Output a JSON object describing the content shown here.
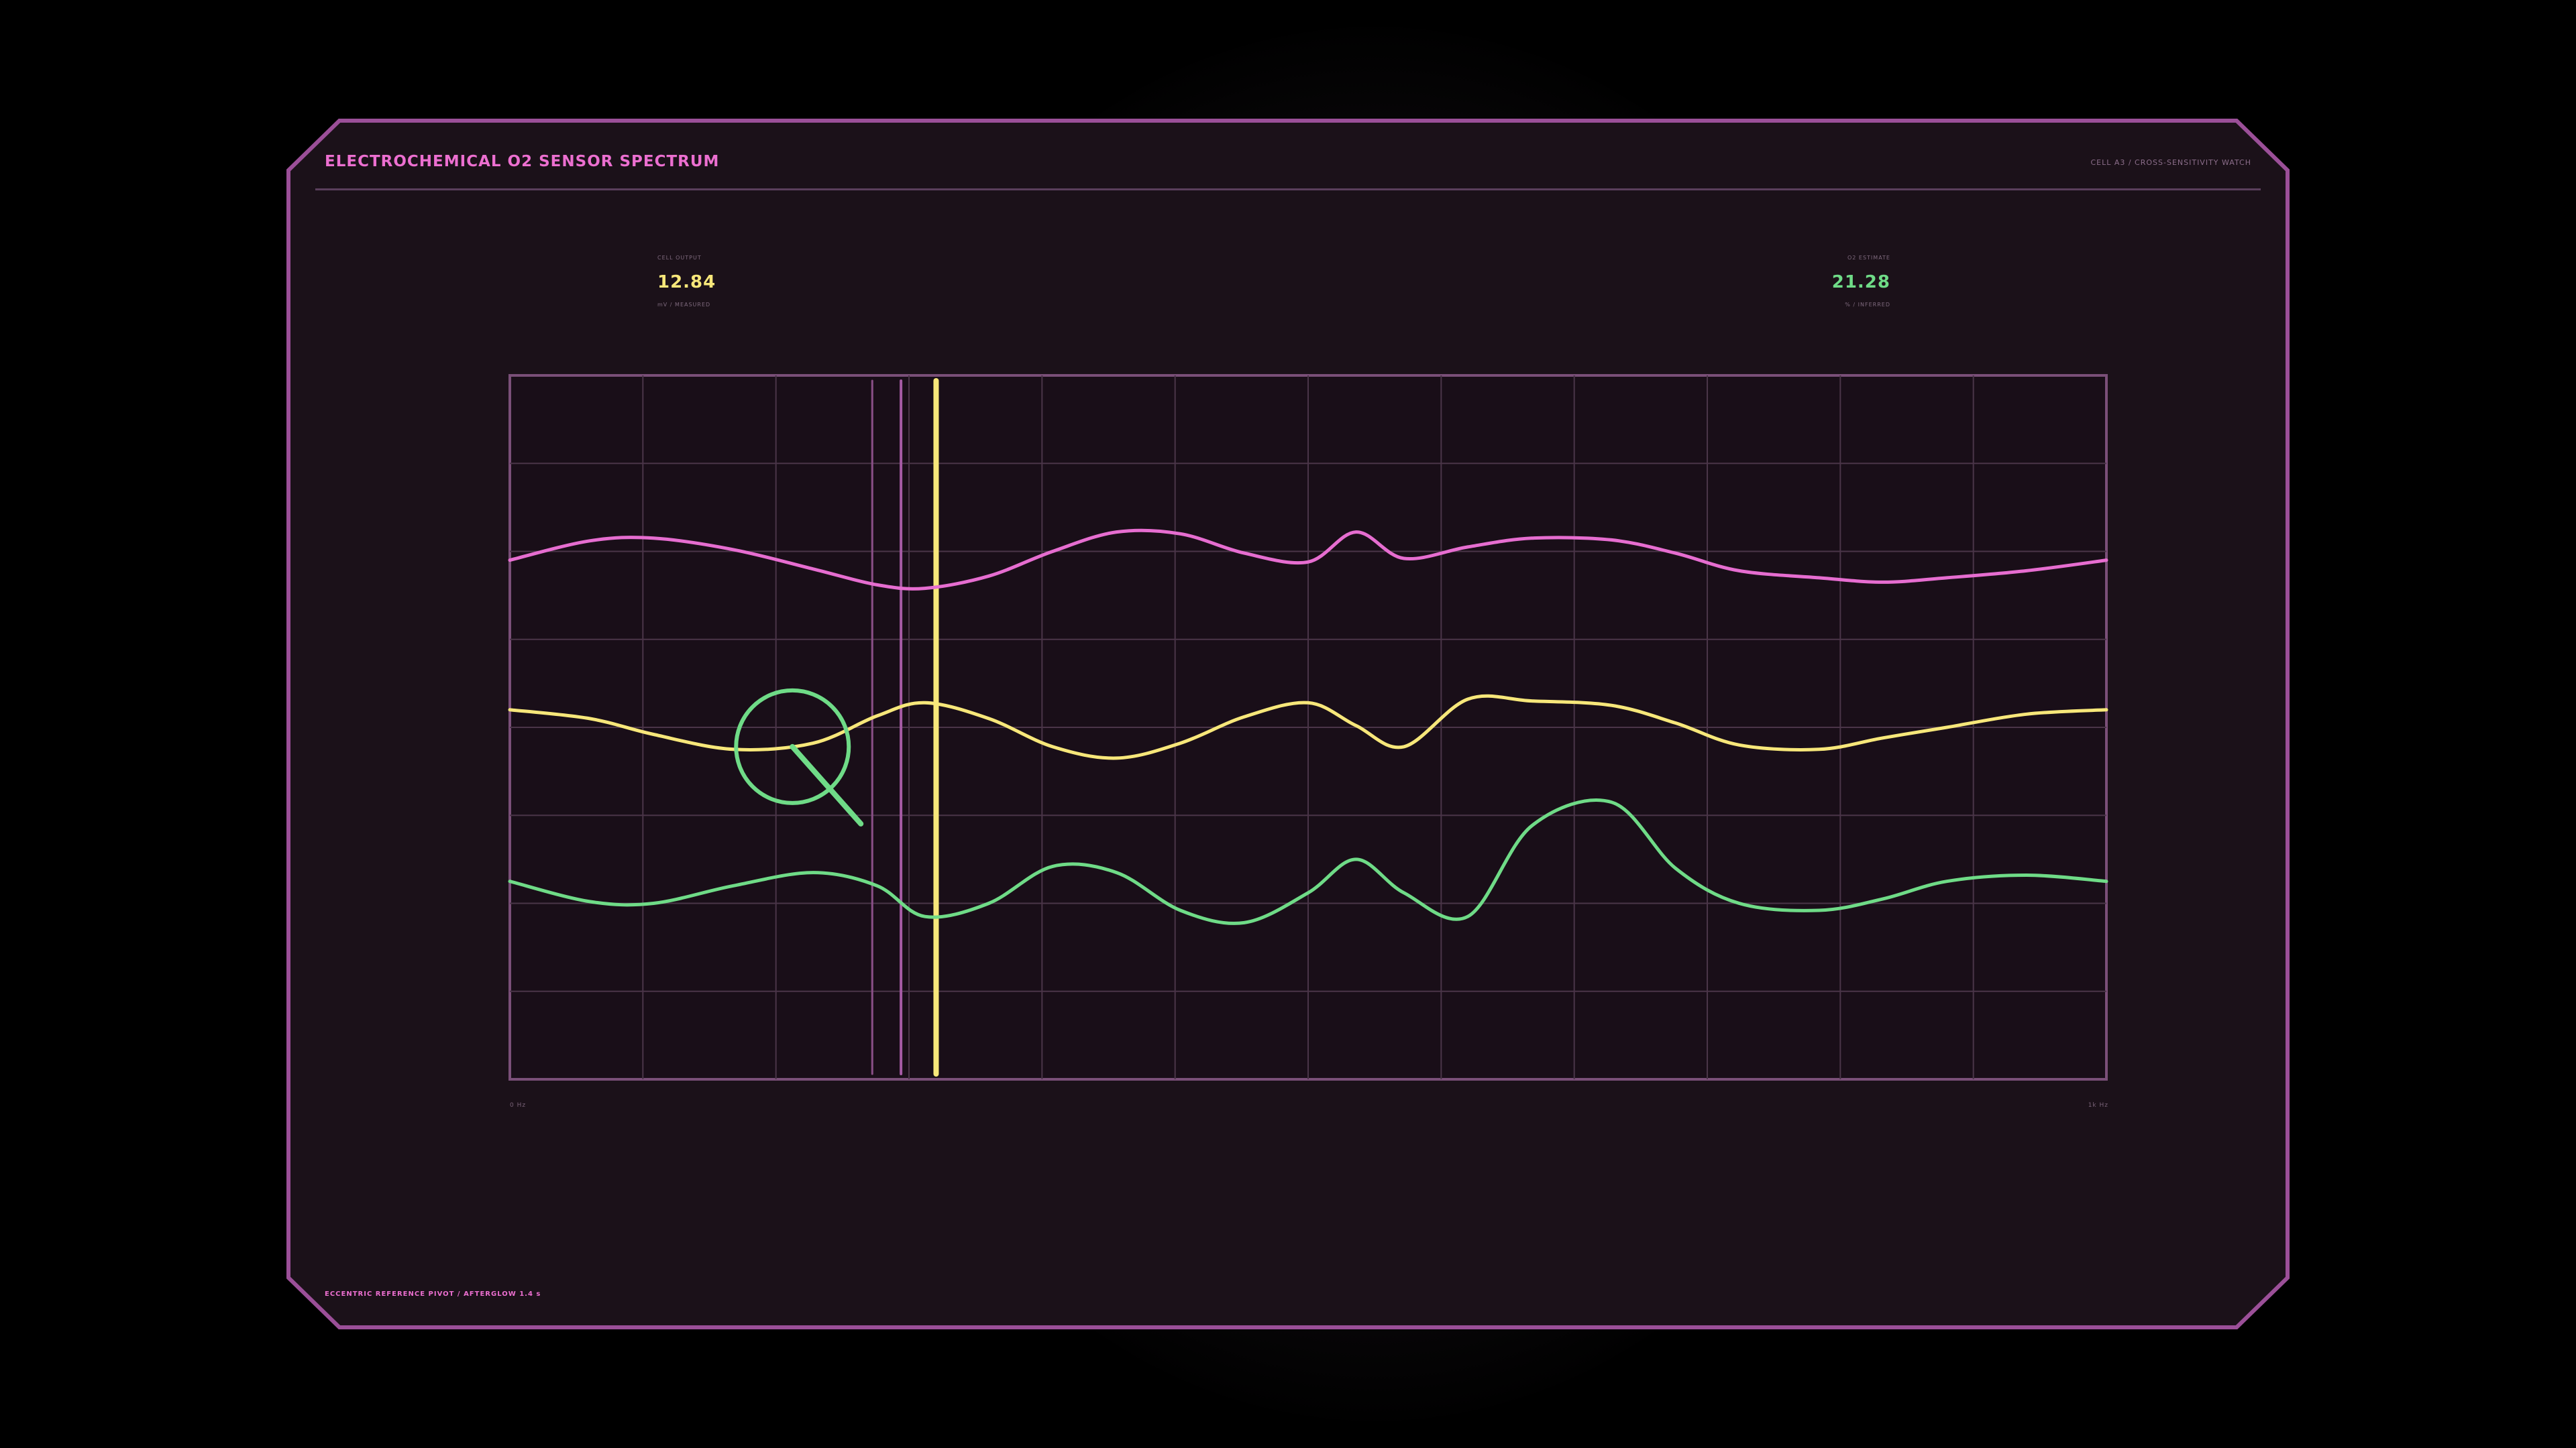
{
  "header": {
    "title": "ELECTROCHEMICAL O2 SENSOR SPECTRUM",
    "cell_tag": "CELL A3 / CROSS-SENSITIVITY WATCH"
  },
  "metrics": {
    "left": {
      "label": "CELL OUTPUT",
      "value": "12.84",
      "sub": "mV / MEASURED"
    },
    "right": {
      "label": "O2 ESTIMATE",
      "value": "21.28",
      "sub": "%  / INFERRED"
    }
  },
  "footer": {
    "text": "ECCENTRIC REFERENCE PIVOT / AFTERGLOW 1.4 s"
  },
  "colors": {
    "accent": "#ec6fd0",
    "yellow": "#f7e77a",
    "green": "#6fdb87",
    "frame": "#9b4f98",
    "panel": "#1b1119",
    "grid": "#4a3548"
  },
  "chart_data": {
    "type": "line",
    "x_tick_labels": [
      "0 Hz",
      "1k Hz"
    ],
    "xlim": [
      0,
      1
    ],
    "ylim": [
      0,
      8
    ],
    "grid": true,
    "x": [
      0,
      0.05,
      0.09,
      0.14,
      0.19,
      0.23,
      0.26,
      0.3,
      0.34,
      0.38,
      0.42,
      0.46,
      0.5,
      0.53,
      0.56,
      0.6,
      0.64,
      0.69,
      0.73,
      0.77,
      0.82,
      0.86,
      0.9,
      0.95,
      1.0
    ],
    "series": [
      {
        "color": "#e66dd0",
        "values": [
          5.9,
          6.12,
          6.15,
          6.02,
          5.8,
          5.62,
          5.58,
          5.72,
          6.0,
          6.22,
          6.2,
          5.98,
          5.88,
          6.22,
          5.92,
          6.05,
          6.15,
          6.13,
          5.98,
          5.78,
          5.7,
          5.65,
          5.7,
          5.78,
          5.9
        ]
      },
      {
        "color": "#f7e77a",
        "values": [
          4.2,
          4.1,
          3.92,
          3.75,
          3.82,
          4.13,
          4.28,
          4.1,
          3.78,
          3.65,
          3.82,
          4.12,
          4.28,
          4.02,
          3.78,
          4.32,
          4.3,
          4.25,
          4.05,
          3.8,
          3.75,
          3.88,
          4.0,
          4.15,
          4.2
        ]
      },
      {
        "color": "#6fdb87",
        "values": [
          2.25,
          2.02,
          2.0,
          2.2,
          2.35,
          2.2,
          1.85,
          2.0,
          2.42,
          2.35,
          1.92,
          1.78,
          2.12,
          2.5,
          2.12,
          1.85,
          2.88,
          3.15,
          2.4,
          2.0,
          1.92,
          2.05,
          2.25,
          2.32,
          2.25
        ]
      }
    ],
    "cursors_x": [
      0.227,
      0.245,
      0.267
    ],
    "lens": {
      "x": 0.177,
      "y": 3.78
    }
  }
}
